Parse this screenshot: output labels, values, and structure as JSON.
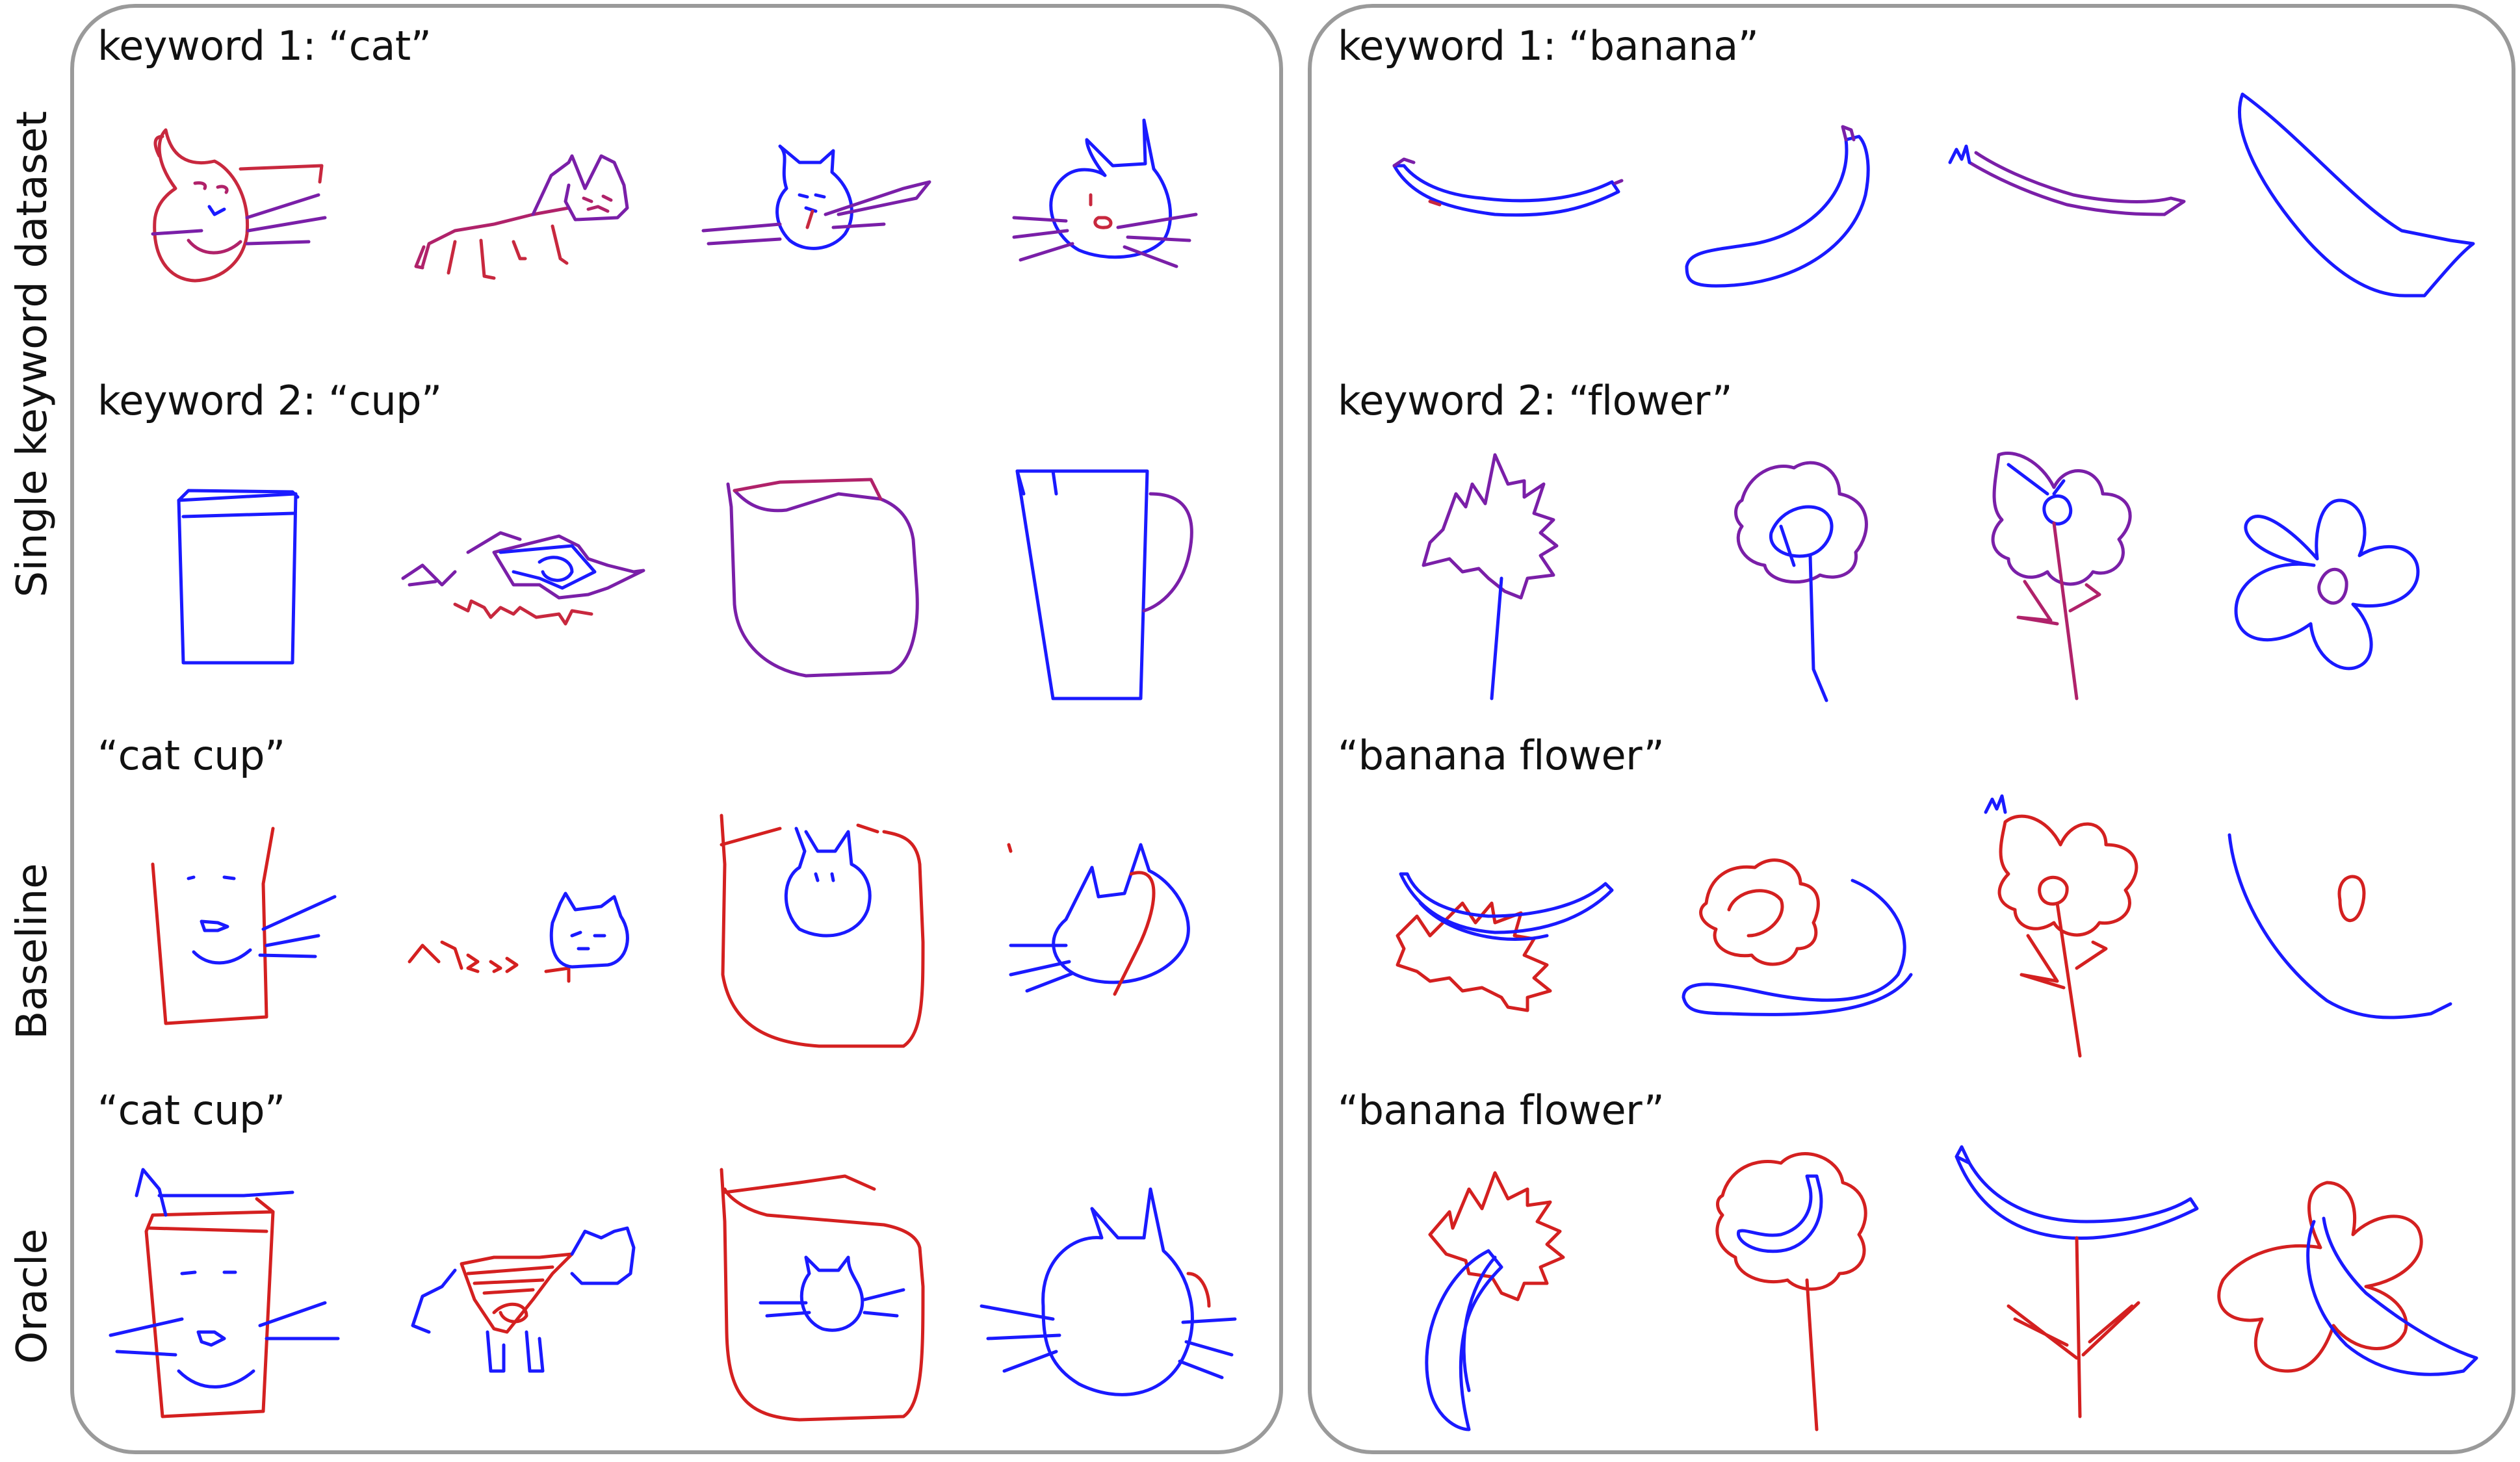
{
  "row_labels": {
    "single": "Single keyword dataset",
    "baseline": "Baseline",
    "oracle": "Oracle"
  },
  "left_panel": {
    "keyword1": "keyword 1: “cat”",
    "keyword2": "keyword 2: “cup”",
    "baseline_query": "“cat cup”",
    "oracle_query": "“cat cup”"
  },
  "right_panel": {
    "keyword1": "keyword 1: “banana”",
    "keyword2": "keyword 2: “flower”",
    "baseline_query": "“banana flower”",
    "oracle_query": "“banana flower”"
  },
  "colors": {
    "stroke_blue": "#1a1aff",
    "stroke_red": "#d42020",
    "stroke_purple": "#7a1fa8",
    "stroke_magenta": "#b0226a",
    "panel_border": "#9a9a9a"
  }
}
